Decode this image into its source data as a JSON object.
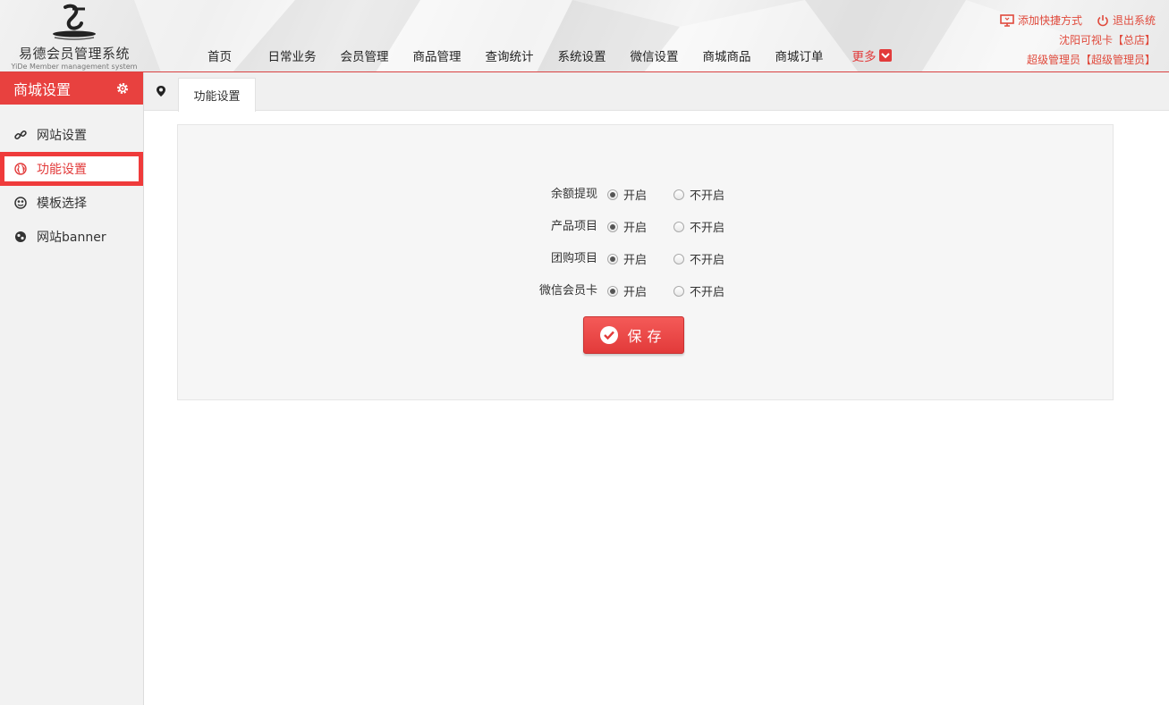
{
  "brand": {
    "name_cn": "易德会员管理系统",
    "name_en": "YiDe Member management system"
  },
  "nav": {
    "items": [
      "首页",
      "日常业务",
      "会员管理",
      "商品管理",
      "查询统计",
      "系统设置",
      "微信设置",
      "商城商品",
      "商城订单"
    ],
    "more_label": "更多"
  },
  "top_right": {
    "add_shortcut": "添加快捷方式",
    "logout": "退出系统",
    "store": "沈阳可视卡【总店】",
    "user": "超级管理员【超级管理员】"
  },
  "sidebar": {
    "title": "商城设置",
    "items": [
      {
        "label": "网站设置",
        "icon": "link-icon"
      },
      {
        "label": "功能设置",
        "icon": "globe-icon",
        "active": true
      },
      {
        "label": "模板选择",
        "icon": "template-icon"
      },
      {
        "label": "网站banner",
        "icon": "banner-icon"
      }
    ]
  },
  "tabs": {
    "current": "功能设置"
  },
  "form": {
    "rows": [
      {
        "label": "余额提现",
        "on": "开启",
        "off": "不开启",
        "value": "开启"
      },
      {
        "label": "产品项目",
        "on": "开启",
        "off": "不开启",
        "value": "开启"
      },
      {
        "label": "团购项目",
        "on": "开启",
        "off": "不开启",
        "value": "开启"
      },
      {
        "label": "微信会员卡",
        "on": "开启",
        "off": "不开启",
        "value": "开启"
      }
    ],
    "save_label": "保存"
  },
  "colors": {
    "accent": "#e8413f",
    "sidebar_bg": "#f2f2f2",
    "panel_bg": "#f6f6f6"
  }
}
